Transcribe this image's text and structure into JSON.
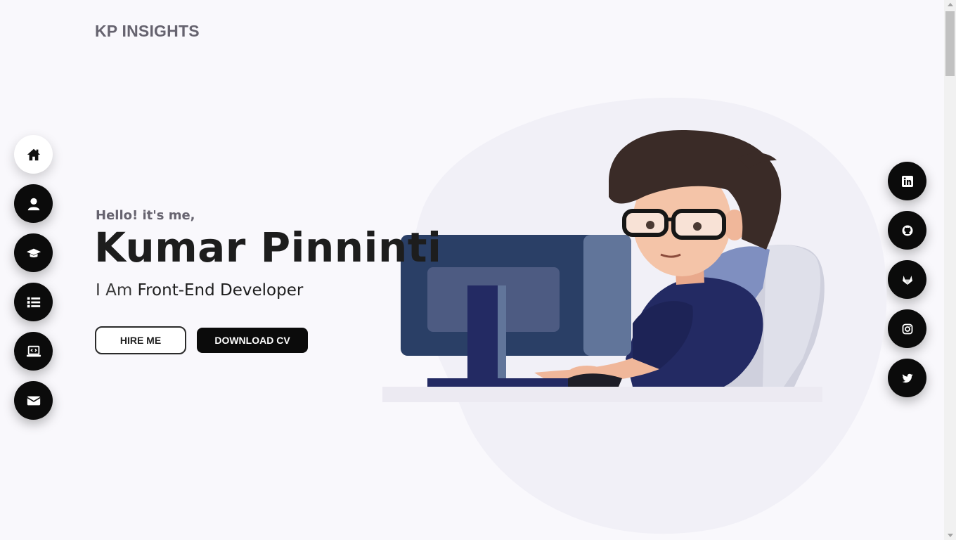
{
  "header": {
    "logo": "KP INSIGHTS"
  },
  "nav": {
    "items": [
      {
        "icon": "home-icon",
        "active": true
      },
      {
        "icon": "user-icon",
        "active": false
      },
      {
        "icon": "graduation-cap-icon",
        "active": false
      },
      {
        "icon": "list-icon",
        "active": false
      },
      {
        "icon": "laptop-code-icon",
        "active": false
      },
      {
        "icon": "envelope-icon",
        "active": false
      }
    ]
  },
  "social": {
    "items": [
      {
        "icon": "linkedin-icon"
      },
      {
        "icon": "github-icon"
      },
      {
        "icon": "gitlab-icon"
      },
      {
        "icon": "instagram-icon"
      },
      {
        "icon": "twitter-icon"
      }
    ]
  },
  "hero": {
    "greeting": "Hello! it's me,",
    "name": "Kumar Pinninti",
    "role_prefix": "I Am",
    "role": "Front-End Developer",
    "hire_label": "HIRE ME",
    "cv_label": "DOWNLOAD CV"
  },
  "colors": {
    "background": "#f9f8fc",
    "accent": "#0b0b0b",
    "muted_text": "#66636f",
    "monitor": "#2a3f66",
    "shirt": "#232a63"
  }
}
